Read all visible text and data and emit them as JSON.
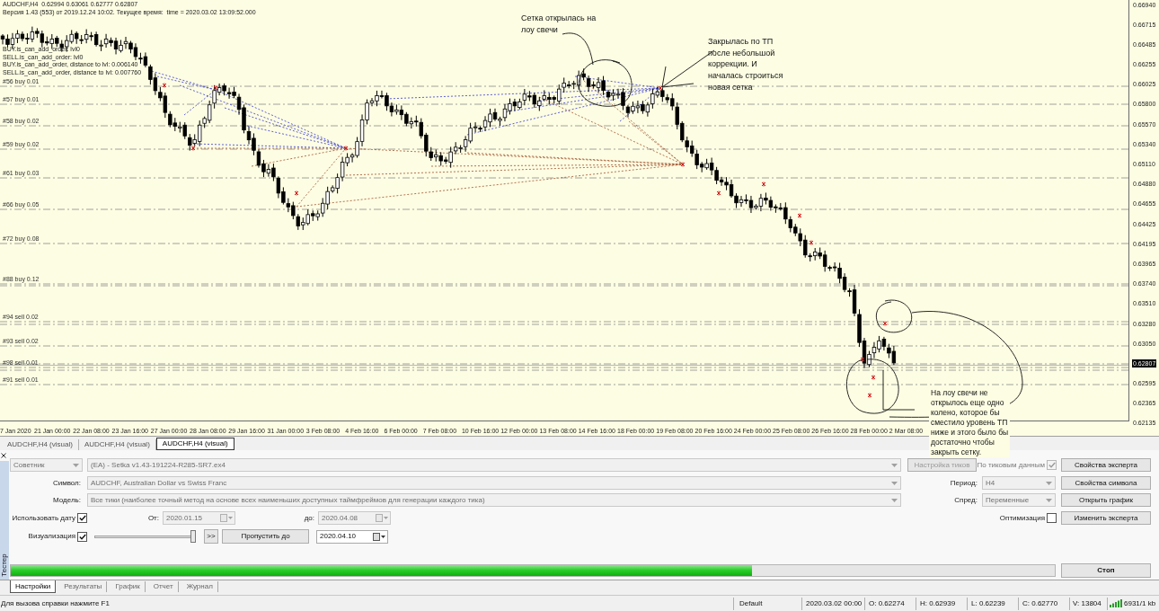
{
  "chart": {
    "title_line": "AUDCHF,H4  0.62994 0.63061 0.62777 0.62807",
    "info_line": "Версия 1.43 (553) от 2019.12.24 10:02. Текущее время:  time = 2020.03.02 13:09:52.000",
    "debug_lines": [
      "BUY.is_can_add_order: lvl0",
      "SELL.is_can_add_order: lvl0",
      "BUY.is_can_add_order, distance to lvl: 0.006140",
      "SELL.is_can_add_order, distance to lvl: 0.007760"
    ],
    "order_lines": [
      {
        "label": "#56 buy 0.01"
      },
      {
        "label": "#57 buy 0.01"
      },
      {
        "label": "#58 buy 0.02"
      },
      {
        "label": "#59 buy 0.02"
      },
      {
        "label": "#61 buy 0.03"
      },
      {
        "label": "#66 buy 0.05"
      },
      {
        "label": "#72 buy 0.08"
      },
      {
        "label": "#88 buy 0.12"
      },
      {
        "label": "#94 sell 0.02"
      },
      {
        "label": "#93 sell 0.02"
      },
      {
        "label": "#98 sell 0.01"
      },
      {
        "label": "#91 sell 0.01"
      }
    ],
    "price_axis": [
      {
        "label": "0.66940",
        "current": false
      },
      {
        "label": "0.66715",
        "current": false
      },
      {
        "label": "0.66485",
        "current": false
      },
      {
        "label": "0.66255",
        "current": false
      },
      {
        "label": "0.66025",
        "current": false
      },
      {
        "label": "0.65800",
        "current": false
      },
      {
        "label": "0.65570",
        "current": false
      },
      {
        "label": "0.65340",
        "current": false
      },
      {
        "label": "0.65110",
        "current": false
      },
      {
        "label": "0.64880",
        "current": false
      },
      {
        "label": "0.64655",
        "current": false
      },
      {
        "label": "0.64425",
        "current": false
      },
      {
        "label": "0.64195",
        "current": false
      },
      {
        "label": "0.63965",
        "current": false
      },
      {
        "label": "0.63740",
        "current": false
      },
      {
        "label": "0.63510",
        "current": false
      },
      {
        "label": "0.63280",
        "current": false
      },
      {
        "label": "0.63050",
        "current": false
      },
      {
        "label": "0.62807",
        "current": true
      },
      {
        "label": "0.62595",
        "current": false
      },
      {
        "label": "0.62365",
        "current": false
      },
      {
        "label": "0.62135",
        "current": false
      }
    ],
    "time_axis": [
      "7 Jan 2020",
      "21 Jan 00:00",
      "22 Jan 08:00",
      "23 Jan 16:00",
      "27 Jan 00:00",
      "28 Jan 08:00",
      "29 Jan 16:00",
      "31 Jan 00:00",
      "3 Feb 08:00",
      "4 Feb 16:00",
      "6 Feb 00:00",
      "7 Feb 08:00",
      "10 Feb 16:00",
      "12 Feb 00:00",
      "13 Feb 08:00",
      "14 Feb 16:00",
      "18 Feb 00:00",
      "19 Feb 08:00",
      "20 Feb 16:00",
      "24 Feb 00:00",
      "25 Feb 08:00",
      "26 Feb 16:00",
      "28 Feb 00:00",
      "2 Mar 08:00"
    ],
    "notes": [
      "Сетка открылась на\nлоу свечи",
      "Закрылась по ТП\nпосле небольшой\nкоррекции. И\nначалась строиться\nновая сетка",
      "На лоу свечи не\nоткрылось еще одно\nколено, которое бы\nсместило уровень ТП\nниже и этого было бы\nдостаточно чтобы\nзакрыть сетку."
    ]
  },
  "chart_tabs": [
    {
      "label": "AUDCHF,H4 (visual)",
      "selected": false
    },
    {
      "label": "AUDCHF,H4 (visual)",
      "selected": false
    },
    {
      "label": "AUDCHF,H4 (visual)",
      "selected": true
    }
  ],
  "tester": {
    "side_label": "Тестер",
    "expert_type": {
      "value": "Советник",
      "disabled": true
    },
    "expert": {
      "value": "(EA) - Setka v1.43-191224-R285-SR7.ex4",
      "disabled": true
    },
    "tick_settings_button": {
      "label": "Настройка тиков",
      "disabled": true
    },
    "tick_data": {
      "label": "По тиковым данным",
      "checked": true,
      "disabled": true
    },
    "symbol": {
      "label": "Символ:",
      "value": "AUDCHF, Australian Dollar vs Swiss Franc",
      "disabled": true
    },
    "period": {
      "label": "Период:",
      "value": "H4",
      "disabled": true
    },
    "model": {
      "label": "Модель:",
      "value": "Все тики (наиболее точный метод на основе всех наименьших доступных таймфреймов для генерации каждого тика)",
      "disabled": true
    },
    "spread": {
      "label": "Спред:",
      "value": "Переменные",
      "disabled": true
    },
    "use_date": {
      "label": "Использовать дату",
      "checked": true
    },
    "date_from": {
      "label": "От:",
      "value": "2020.01.15",
      "disabled": true
    },
    "date_to": {
      "label": "до:",
      "value": "2020.04.08",
      "disabled": true
    },
    "optimization": {
      "label": "Оптимизация",
      "checked": false
    },
    "visualization": {
      "label": "Визуализация",
      "checked": true
    },
    "speed": {
      "level": 1
    },
    "fast_forward_button": ">>",
    "skip_button": "Пропустить до",
    "skip_date": {
      "value": "2020.04.10",
      "disabled": false
    },
    "progress": {
      "level": 0.71
    },
    "side_buttons": [
      "Свойства эксперта",
      "Свойства символа",
      "Открыть график",
      "Изменить эксперта"
    ],
    "stop_button": "Стоп"
  },
  "tester_tabs": [
    {
      "label": "Настройки",
      "selected": true
    },
    {
      "label": "Результаты",
      "selected": false
    },
    {
      "label": "График",
      "selected": false
    },
    {
      "label": "Отчет",
      "selected": false
    },
    {
      "label": "Журнал",
      "selected": false
    }
  ],
  "status_bar": {
    "help": "Для вызова справки нажмите F1",
    "profile": "Default",
    "time": "2020.03.02 00:00",
    "open": "O: 0.62274",
    "high": "H: 0.62939",
    "low": "L: 0.62239",
    "close": "C: 0.62770",
    "volume": "V: 13804",
    "traffic": "6931/1 kb"
  }
}
